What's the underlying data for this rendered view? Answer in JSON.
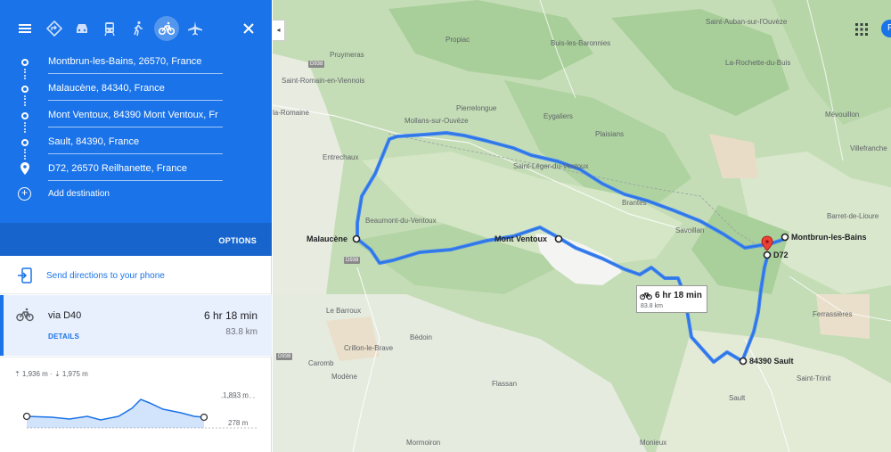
{
  "modes": [
    {
      "name": "directions-icon"
    },
    {
      "name": "car-icon"
    },
    {
      "name": "transit-icon"
    },
    {
      "name": "walk-icon"
    },
    {
      "name": "bicycle-icon",
      "active": true
    },
    {
      "name": "flight-icon"
    }
  ],
  "stops": [
    {
      "label": "Montbrun-les-Bains, 26570, France"
    },
    {
      "label": "Malaucène, 84340, France"
    },
    {
      "label": "Mont Ventoux, 84390 Mont Ventoux, Fr"
    },
    {
      "label": "Sault, 84390, France"
    },
    {
      "label": "D72, 26570 Reilhanette, France"
    }
  ],
  "add_destination": "Add destination",
  "options": "OPTIONS",
  "send_directions": "Send directions to your phone",
  "route": {
    "via": "via D40",
    "time": "6 hr 18 min",
    "distance": "83.8 km",
    "details": "DETAILS"
  },
  "elevation": {
    "stats": "⇡ 1,936 m · ⇣ 1,975 m",
    "max": "1,893 m",
    "min": "278 m"
  },
  "map": {
    "towns": {
      "malaucene": "Malaucène",
      "mont_ventoux": "Mont Ventoux",
      "montbrun": "Montbrun-les-Bains",
      "d72": "D72",
      "sault": "84390 Sault"
    },
    "places": [
      "Propiac",
      "Buis-les-Baronnies",
      "Saint-Auban-sur-l'Ouvèze",
      "Pruymeras",
      "Saint-Romain-en-Viennois",
      "La-Rochette-du-Buis",
      "la-Romaine",
      "Pierrelongue",
      "Mollans-sur-Ouvèze",
      "Eygaliers",
      "Plaisians",
      "Mévouillon",
      "Villefranche",
      "Entrechaux",
      "Saint-Léger-du-Ventoux",
      "Brantes",
      "Savoillan",
      "Barret-de-Lioure",
      "Beaumont-du-Ventoux",
      "Le Barroux",
      "Bédoin",
      "Crillon-le-Brave",
      "Caromb",
      "Modène",
      "Flassan",
      "Ferrassières",
      "Saint-Trinit",
      "Sault",
      "Mormoiron",
      "Monieux"
    ],
    "roads": [
      "D938",
      "D938",
      "D938"
    ],
    "route_box": {
      "time": "6 hr 18 min",
      "distance": "83.8 km"
    },
    "avatar": "F"
  },
  "colors": {
    "panel_blue": "#1a73e8",
    "route_line": "#4285f4"
  }
}
